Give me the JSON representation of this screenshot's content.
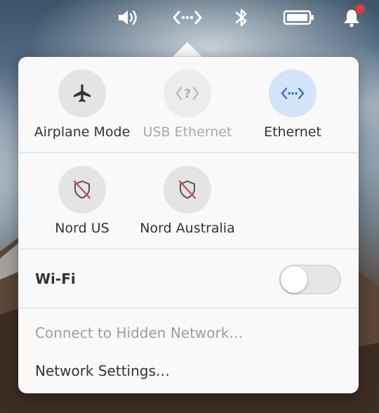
{
  "topbar": {
    "icons": [
      "volume-icon",
      "network-icon",
      "bluetooth-icon",
      "battery-icon",
      "notifications-icon"
    ],
    "notification_badge_color": "#e23b3b"
  },
  "popover": {
    "tiles_row1": [
      {
        "label": "Airplane Mode",
        "icon": "airplane-icon",
        "state": "off"
      },
      {
        "label": "USB Ethernet",
        "icon": "usb-ethernet-unknown-icon",
        "state": "disabled"
      },
      {
        "label": "Ethernet",
        "icon": "ethernet-icon",
        "state": "active"
      }
    ],
    "tiles_row2": [
      {
        "label": "Nord US",
        "icon": "vpn-shield-off-icon",
        "state": "off"
      },
      {
        "label": "Nord Australia",
        "icon": "vpn-shield-off-icon",
        "state": "off"
      }
    ],
    "wifi": {
      "label": "Wi-Fi",
      "enabled": false
    },
    "menu": {
      "hidden_network": "Connect to Hidden Network…",
      "network_settings": "Network Settings…"
    }
  },
  "colors": {
    "active_tile": "#d3e3f8",
    "active_icon": "#3d6cb0",
    "vpn_slash": "#d24646"
  }
}
